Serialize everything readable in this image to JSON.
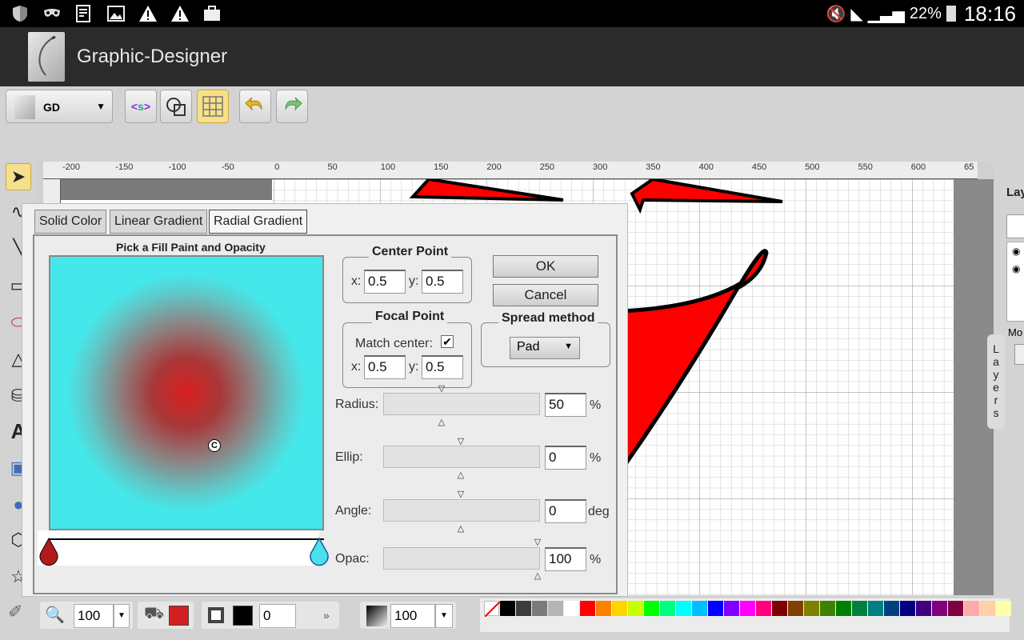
{
  "statusbar": {
    "battery": "22%",
    "time": "18:16"
  },
  "app": {
    "title": "Graphic-Designer"
  },
  "toolbar": {
    "doc_select": "GD"
  },
  "layers": {
    "label": "Lay",
    "tab_label": "Layers",
    "mo_label": "Mo"
  },
  "dialog": {
    "tabs": [
      "Solid Color",
      "Linear Gradient",
      "Radial Gradient"
    ],
    "pick_label": "Pick a Fill Paint and Opacity",
    "center_point": {
      "legend": "Center Point",
      "x_label": "x:",
      "x": "0.5",
      "y_label": "y:",
      "y": "0.5"
    },
    "focal_point": {
      "legend": "Focal Point",
      "match_label": "Match center:",
      "x_label": "x:",
      "x": "0.5",
      "y_label": "y:",
      "y": "0.5"
    },
    "spread": {
      "legend": "Spread method",
      "value": "Pad"
    },
    "ok": "OK",
    "cancel": "Cancel",
    "center_glyph": "C",
    "radius": {
      "label": "Radius:",
      "value": "50",
      "unit": "%"
    },
    "ellip": {
      "label": "Ellip:",
      "value": "0",
      "unit": "%"
    },
    "angle": {
      "label": "Angle:",
      "value": "0",
      "unit": "deg"
    },
    "opac": {
      "label": "Opac:",
      "value": "100",
      "unit": "%"
    },
    "stops": {
      "start_color": "#b31b1b",
      "end_color": "#4ae0ee"
    }
  },
  "ruler": {
    "ticks": [
      "-200",
      "-150",
      "-100",
      "-50",
      "0",
      "50",
      "100",
      "150",
      "200",
      "250",
      "300",
      "350",
      "400",
      "450",
      "500",
      "550",
      "600",
      "65"
    ]
  },
  "bottombar": {
    "zoom": "100",
    "fill_color": "#d21f1f",
    "stroke_color": "#000000",
    "stroke_width": "0",
    "more": "»",
    "opacity": "100"
  },
  "palette": [
    "#000000",
    "#3c3c3c",
    "#7a7a7a",
    "#b4b4b4",
    "#ffffff",
    "#ff0000",
    "#ff7f00",
    "#ffd400",
    "#c8ff00",
    "#00ff00",
    "#00ff7f",
    "#00ffff",
    "#00bfff",
    "#0000ff",
    "#7f00ff",
    "#ff00ff",
    "#ff007f",
    "#800000",
    "#804000",
    "#808000",
    "#408000",
    "#008000",
    "#008040",
    "#008080",
    "#004080",
    "#000080",
    "#400080",
    "#800080",
    "#800040",
    "#ffaaaa",
    "#ffd0aa",
    "#ffffaa"
  ]
}
